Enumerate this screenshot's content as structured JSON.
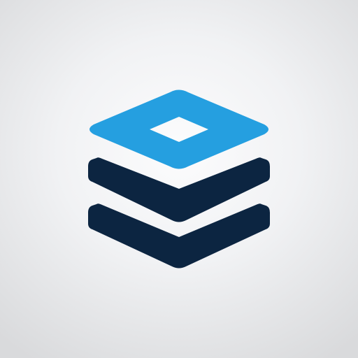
{
  "icon": {
    "name": "stacked-layers-logo",
    "colors": {
      "top_layer": "#259fe0",
      "lower_layers": "#0c2541",
      "background_light": "#fcfcfd",
      "background_edge": "#d9dadc"
    }
  }
}
